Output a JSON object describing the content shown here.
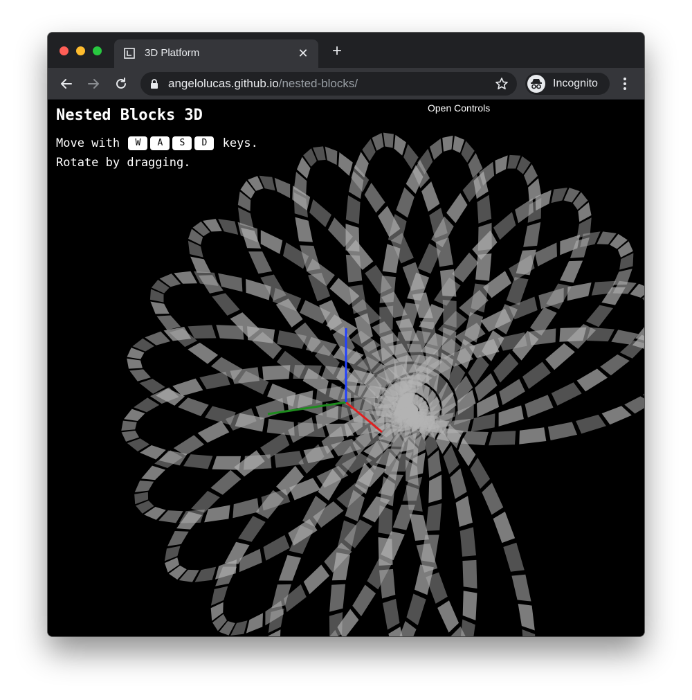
{
  "browser": {
    "tab_title": "3D Platform",
    "url_host": "angelolucas.github.io",
    "url_path": "/nested-blocks/",
    "profile_label": "Incognito",
    "icons": [
      "back-icon",
      "forward-icon",
      "reload-icon",
      "lock-icon",
      "star-icon",
      "incognito-icon",
      "kebab-menu-icon",
      "tab-close-icon",
      "new-tab-icon"
    ]
  },
  "page": {
    "title": "Nested Blocks 3D",
    "move_prefix": "Move with",
    "keys": [
      "W",
      "A",
      "S",
      "D"
    ],
    "move_suffix": "keys.",
    "rotate_text": "Rotate by dragging.",
    "controls_label": "Open Controls"
  },
  "colors": {
    "background": "#000000",
    "block_fill": "#b4b4b4",
    "axis_x": "#e02020",
    "axis_y": "#1e8c1e",
    "axis_z": "#2040ff"
  }
}
